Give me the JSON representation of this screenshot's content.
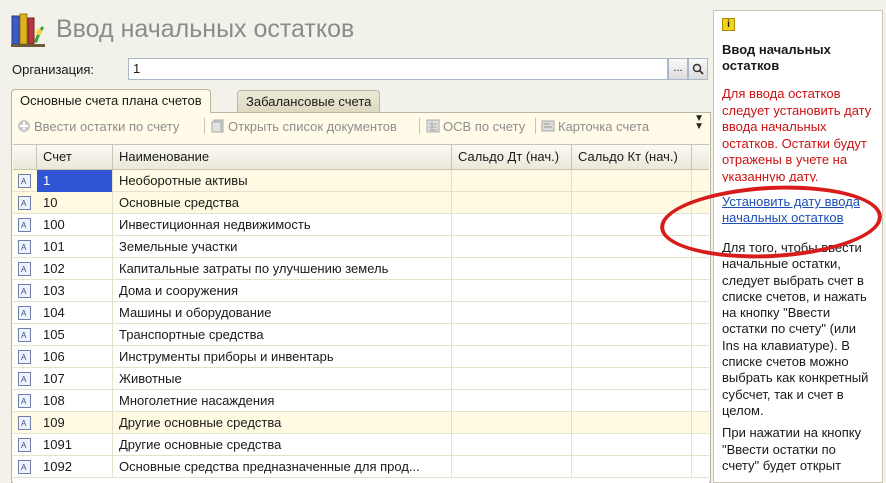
{
  "header": {
    "title": "Ввод начальных остатков"
  },
  "organization": {
    "label": "Организация:",
    "value": "1",
    "select_btn": "...",
    "search_btn": "🔍"
  },
  "tabs": [
    {
      "label": "Основные счета плана счетов",
      "active": true
    },
    {
      "label": "Забалансовые счета",
      "active": false
    }
  ],
  "toolbar": {
    "enter_balances": "Ввести остатки по счету",
    "open_docs": "Открыть список документов",
    "osv": "ОСВ по счету",
    "account_card": "Карточка счета",
    "more": "»"
  },
  "grid": {
    "columns": [
      "Счет",
      "Наименование",
      "Сальдо Дт (нач.)",
      "Сальдо Кт (нач.)"
    ],
    "rows": [
      {
        "code": "1",
        "name": "Необоротные активы",
        "highlight": true,
        "selected": true
      },
      {
        "code": "10",
        "name": "Основные средства",
        "highlight": true
      },
      {
        "code": "100",
        "name": "Инвестиционная недвижимость"
      },
      {
        "code": "101",
        "name": "Земельные участки"
      },
      {
        "code": "102",
        "name": "Капитальные затраты по улучшению земель"
      },
      {
        "code": "103",
        "name": "Дома и сооружения"
      },
      {
        "code": "104",
        "name": "Машины и оборудование"
      },
      {
        "code": "105",
        "name": "Транспортные средства"
      },
      {
        "code": "106",
        "name": "Инструменты приборы и инвентарь"
      },
      {
        "code": "107",
        "name": "Животные"
      },
      {
        "code": "108",
        "name": "Многолетние насаждения"
      },
      {
        "code": "109",
        "name": "Другие основные средства",
        "highlight": true
      },
      {
        "code": "1091",
        "name": "Другие основные средства"
      },
      {
        "code": "1092",
        "name": "Основные средства предназначенные для прод..."
      }
    ]
  },
  "side_panel": {
    "title": "Ввод начальных остатков",
    "warning": "Для ввода остатков следует установить дату ввода начальных остатков. Остатки будут отражены в учете на указанную дату.",
    "link": "Установить дату ввода начальных остатков",
    "text1": "Для того, чтобы ввести начальные остатки, следует выбрать счет в списке счетов, и нажать на кнопку \"Ввести остатки по счету\" (или Ins на клавиатуре). В списке счетов можно выбрать как конкретный субсчет, так и счет в целом.",
    "text2": "При нажатии на кнопку \"Ввести остатки по счету\" будет открыт"
  },
  "colors": {
    "selection": "#2f55d4",
    "link": "#1c4fb5",
    "warning": "#cc1111",
    "annotation": "#d81c1c"
  }
}
